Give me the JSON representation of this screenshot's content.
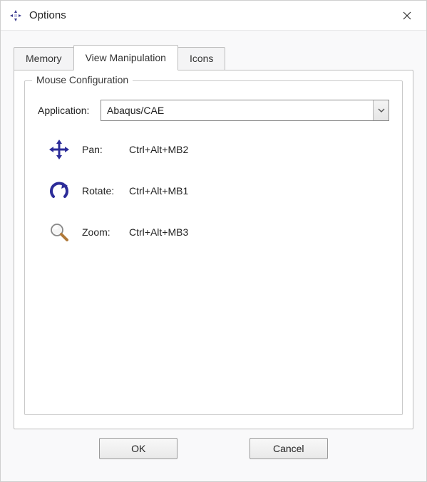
{
  "window": {
    "title": "Options"
  },
  "tabs": {
    "memory": "Memory",
    "view_manipulation": "View Manipulation",
    "icons": "Icons"
  },
  "fieldset": {
    "legend": "Mouse Configuration",
    "application_label": "Application:",
    "application_value": "Abaqus/CAE",
    "bindings": {
      "pan": {
        "label": "Pan:",
        "keys": "Ctrl+Alt+MB2"
      },
      "rotate": {
        "label": "Rotate:",
        "keys": "Ctrl+Alt+MB1"
      },
      "zoom": {
        "label": "Zoom:",
        "keys": "Ctrl+Alt+MB3"
      }
    }
  },
  "buttons": {
    "ok": "OK",
    "cancel": "Cancel"
  }
}
